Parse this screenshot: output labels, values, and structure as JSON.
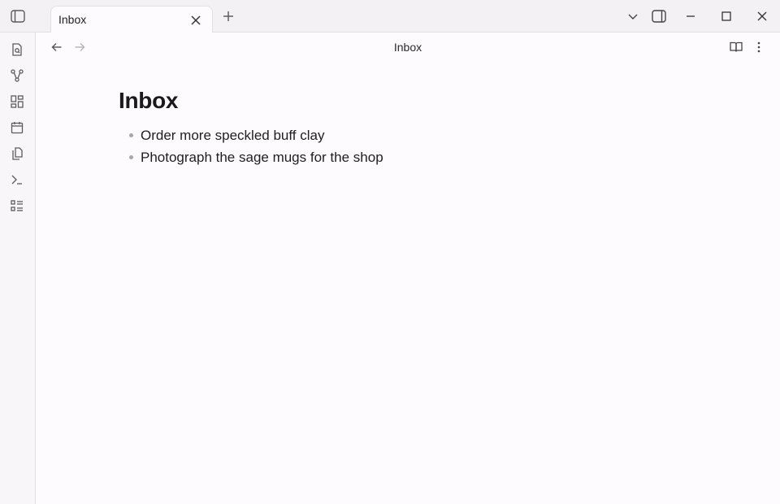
{
  "tabs": [
    {
      "title": "Inbox",
      "active": true
    }
  ],
  "view": {
    "title": "Inbox"
  },
  "note": {
    "heading": "Inbox",
    "items": [
      "Order more speckled buff clay",
      "Photograph the sage mugs for the shop"
    ]
  },
  "icons": {
    "sidebar_toggle": "sidebar-left-icon",
    "tab_close": "close-icon",
    "new_tab": "plus-icon",
    "tab_list": "chevron-down-icon",
    "right_sidebar": "sidebar-right-icon",
    "minimize": "minimize-icon",
    "maximize": "maximize-icon",
    "close_window": "close-icon",
    "ribbon": [
      "file-search-icon",
      "graph-icon",
      "dashboard-icon",
      "calendar-icon",
      "copy-files-icon",
      "terminal-icon",
      "checklist-icon"
    ],
    "back": "arrow-left-icon",
    "forward": "arrow-right-icon",
    "reading_view": "book-open-icon",
    "more_options": "more-vertical-icon"
  },
  "colors": {
    "background": "#fdfbfd",
    "titlebar": "#f3f1f3",
    "border": "#e3e0e3",
    "icon": "#5c5c5c",
    "bullet": "#a8a8a8"
  }
}
